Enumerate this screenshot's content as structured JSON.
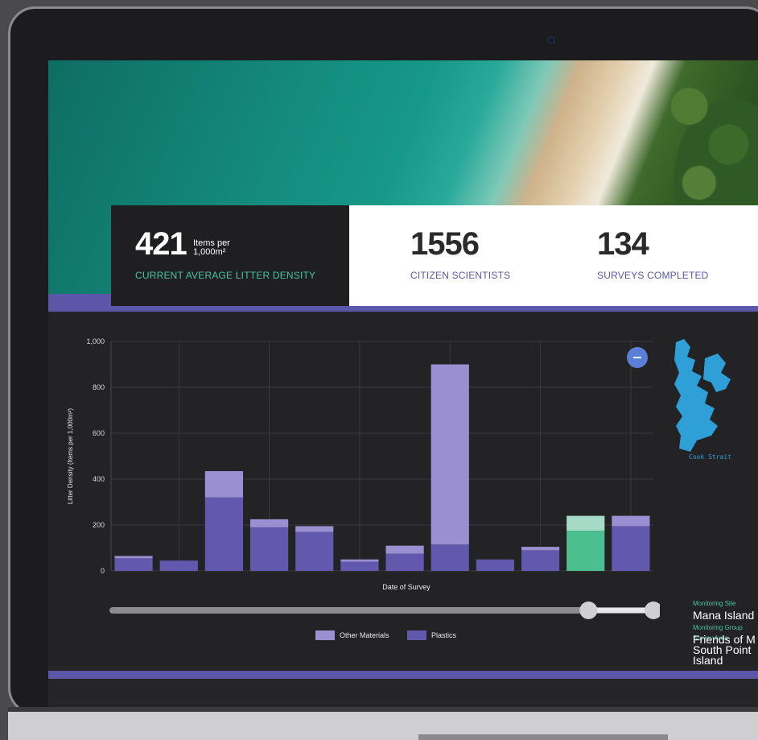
{
  "stats": {
    "density_value": "421",
    "density_unit_line1": "Items per",
    "density_unit_line2": "1,000m²",
    "density_caption": "CURRENT AVERAGE LITTER DENSITY",
    "citizens_value": "1556",
    "citizens_caption": "CITIZEN SCIENTISTS",
    "surveys_value": "134",
    "surveys_caption": "SURVEYS COMPLETED"
  },
  "chart_data": {
    "type": "bar",
    "stacked": true,
    "xlabel": "Date of Survey",
    "ylabel": "Litter Density (Items per 1,000m²)",
    "ylim": [
      0,
      1000
    ],
    "yticks": [
      0,
      200,
      400,
      600,
      800,
      1000
    ],
    "ytick_labels": [
      "0",
      "200",
      "400",
      "600",
      "800",
      "1,000"
    ],
    "grid": true,
    "legend_position": "bottom",
    "highlighted_index": 10,
    "series": [
      {
        "name": "Plastics",
        "values": [
          55,
          45,
          320,
          190,
          170,
          40,
          75,
          115,
          50,
          90,
          175,
          195
        ]
      },
      {
        "name": "Other Materials",
        "values": [
          10,
          0,
          115,
          35,
          25,
          10,
          35,
          785,
          0,
          15,
          65,
          45
        ]
      }
    ],
    "colors": {
      "Plastics": "#6258ad",
      "Other Materials": "#9a8fd0",
      "highlight_plastics": "#4cbf8e",
      "highlight_other": "#a6dcc7"
    }
  },
  "slider": {
    "range_start": 0.88,
    "range_end": 1.0
  },
  "collapse_button_icon": "minus-icon",
  "map": {
    "label": "Cook Strait"
  },
  "details": {
    "site_label": "Monitoring Site",
    "site_value": "Mana Island",
    "area_label": "Survey Area",
    "area_value": "South Point Island",
    "group_label": "Monitoring Group",
    "group_value": "Friends of M"
  }
}
